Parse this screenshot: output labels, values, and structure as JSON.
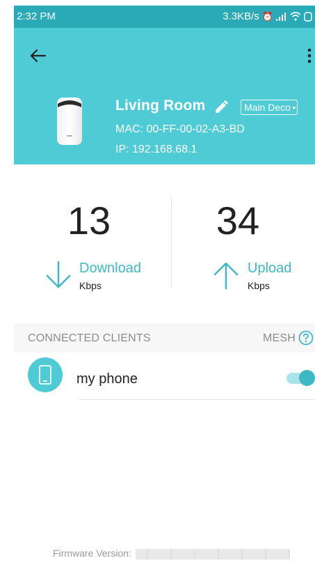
{
  "status_bar": {
    "time": "2:32 PM",
    "net_speed": "3.3KB/s",
    "icons": [
      "alarm-icon",
      "signal-icon",
      "wifi-icon",
      "battery-icon"
    ]
  },
  "header": {
    "background": "#4fcbd6",
    "device_name": "Living Room",
    "role_badge": "Main Deco",
    "mac": "MAC: 00-FF-00-02-A3-BD",
    "ip": "IP: 192.168.68.1"
  },
  "stats": {
    "download": {
      "value": "13",
      "label": "Download",
      "unit": "Kbps"
    },
    "upload": {
      "value": "34",
      "label": "Upload",
      "unit": "Kbps"
    }
  },
  "clients_section": {
    "title": "CONNECTED CLIENTS",
    "mesh_label": "MESH"
  },
  "clients": [
    {
      "name": "my phone",
      "icon": "phone-icon",
      "mesh_enabled": true
    }
  ],
  "footer": {
    "firmware_label": "Firmware Version:"
  },
  "colors": {
    "accent": "#3fb8c6",
    "status_bar": "#2aa9b6"
  }
}
